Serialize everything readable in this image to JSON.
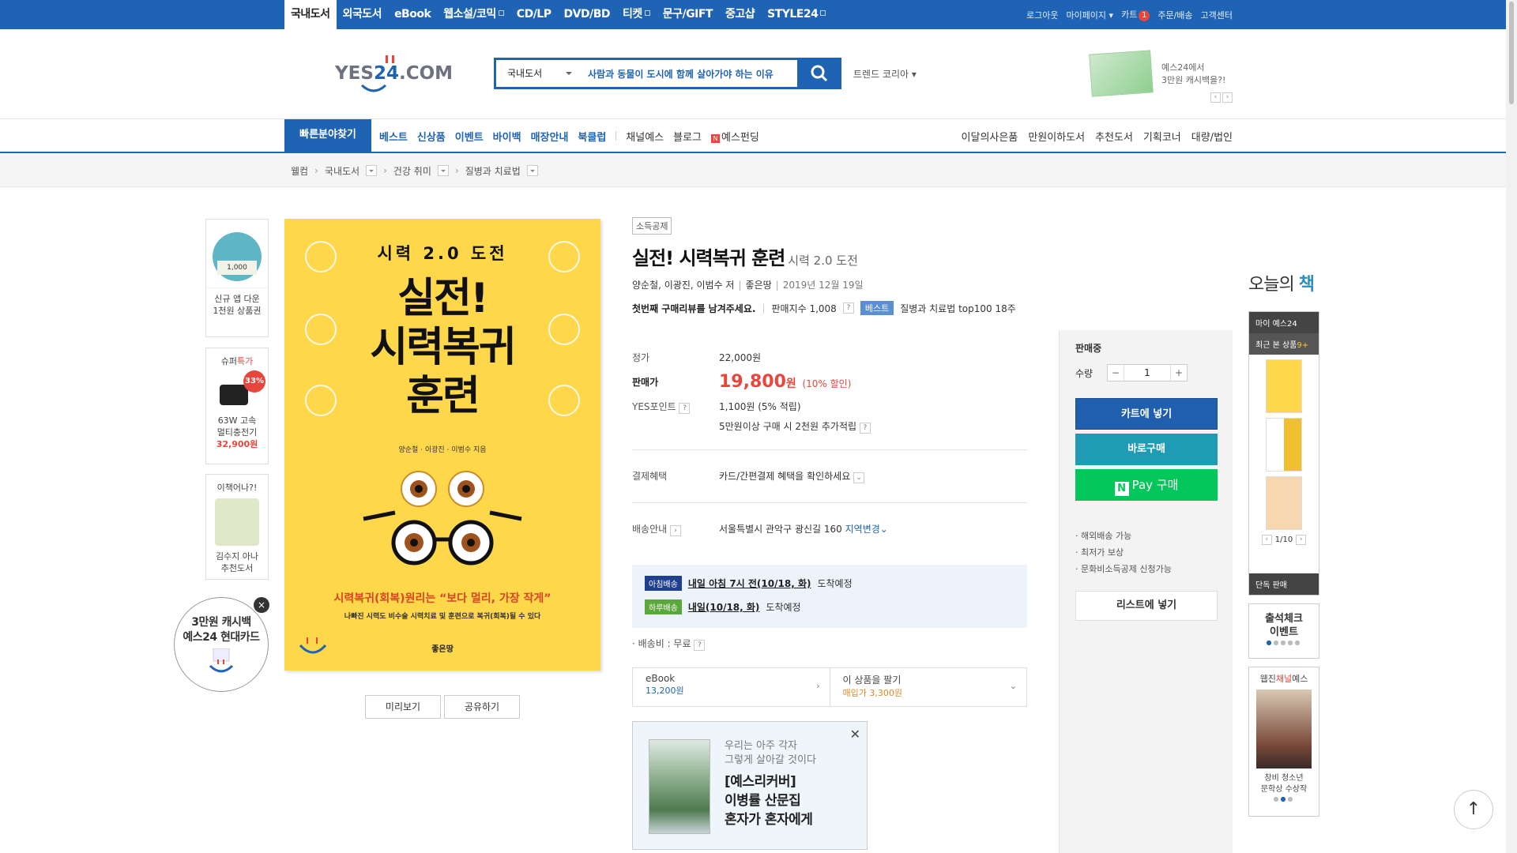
{
  "topbar": {
    "tabs": [
      {
        "label": "국내도서",
        "active": true
      },
      {
        "label": "외국도서"
      },
      {
        "label": "eBook"
      },
      {
        "label": "웹소설/코믹",
        "more": true
      },
      {
        "label": "CD/LP"
      },
      {
        "label": "DVD/BD"
      },
      {
        "label": "티켓",
        "more": true
      },
      {
        "label": "문구/GIFT"
      },
      {
        "label": "중고샵"
      },
      {
        "label": "STYLE24",
        "more": true
      }
    ],
    "util": {
      "logout": "로그아웃",
      "mypage": "마이페이지",
      "cart": "카트",
      "cart_count": "1",
      "orders": "주문/배송",
      "cs": "고객센터"
    }
  },
  "header": {
    "logo": {
      "yes": "YES",
      "n24": "24",
      "com": ".COM"
    },
    "search": {
      "category": "국내도서",
      "query": "사람과 동물이 도시에 함께 살아가야 하는 이유"
    },
    "trend": "트렌드 코리아",
    "promo": {
      "line1": "예스24에서",
      "line2": "3만원 캐시백을?!"
    }
  },
  "gnb": {
    "quick": "빠른분야찾기",
    "menu_blue": [
      "베스트",
      "신상품",
      "이벤트",
      "바이백",
      "매장안내",
      "북클럽"
    ],
    "menu_gray": [
      "채널예스",
      "블로그"
    ],
    "funding": "예스펀딩",
    "right": [
      "이달의사은품",
      "만원이하도서",
      "추천도서",
      "기획코너",
      "대량/법인"
    ]
  },
  "breadcrumb": [
    "웰컴",
    "국내도서",
    "건강 취미",
    "질병과 치료법"
  ],
  "side_ads": {
    "app": {
      "coin": "1,000",
      "line1": "신규 앱 다운",
      "line2": "1천원 상품권"
    },
    "super": {
      "title_a": "슈퍼",
      "title_b": "특가",
      "pct": "33%",
      "line1": "63W 고속",
      "line2": "멀티충전기",
      "price": "32,900원"
    },
    "book": {
      "title": "이책어나?!",
      "line1": "김수지 아나",
      "line2": "추천도서"
    },
    "circle": {
      "line1": "3만원 캐시백",
      "line2": "예스24 현대카드"
    }
  },
  "cover": {
    "subtitle": "시력 2.0 도전",
    "title_lines": [
      "실전!",
      "시력복귀",
      "훈련"
    ],
    "authors": "양순철 · 이광진 · 이범수 지음",
    "tagline": "시력복귀(회복)원리는 “보다 멀리, 가장 작게”",
    "tagline2": "나빠진 시력도 비수술 시력치료 및 훈련으로 복귀(회복)될 수 있다",
    "publisher": "좋은땅"
  },
  "cover_buttons": {
    "preview": "미리보기",
    "share": "공유하기"
  },
  "product": {
    "badge": "소득공제",
    "title": "실전! 시력복귀 훈련",
    "subtitle": "시력 2.0 도전",
    "authors": "양순철, 이광진, 이범수 저",
    "publisher": "좋은땅",
    "date": "2019년 12월 19일",
    "review_prompt": "첫번째 구매리뷰를 남겨주세요.",
    "sales_index": "판매지수 1,008",
    "best_tag": "베스트",
    "rank": "질병과 치료법 top100 18주"
  },
  "price": {
    "list_label": "정가",
    "list_value": "22,000원",
    "sale_label": "판매가",
    "sale_value": "19,800",
    "sale_unit": "원",
    "discount": "(10% 할인)",
    "points_label": "YES포인트",
    "points_value": "1,100원 (5% 적립)",
    "points_extra": "5만원이상 구매 시 2천원 추가적립",
    "pay_label": "결제혜택",
    "pay_value": "카드/간편결제 혜택을 확인하세요",
    "ship_label": "배송안내",
    "ship_address": "서울특별시 관악구 광신길 160",
    "ship_change": "지역변경"
  },
  "delivery": {
    "morning_tag": "아침배송",
    "morning_time": "내일 아침 7시 전(10/18, 화)",
    "morning_suffix": "도착예정",
    "day_tag": "하루배송",
    "day_time": "내일(10/18, 화)",
    "day_suffix": "도착예정",
    "fee": "· 배송비 : 무료"
  },
  "ebook": {
    "label": "eBook",
    "price": "13,200원",
    "sell_label": "이 상품을 팔기",
    "sell_price": "매입가 3,300원"
  },
  "banner": {
    "line1": "우리는 아주 각자",
    "line2": "그렇게 살아갈 것이다",
    "t1": "[예스리커버]",
    "t2": "이병률 산문집",
    "t3": "혼자가 혼자에게"
  },
  "buy": {
    "status": "판매중",
    "qty_label": "수량",
    "qty": "1",
    "cart": "카트에 넣기",
    "buy_now": "바로구매",
    "npay": "Pay 구매",
    "notes": [
      "· 해외배송 가능",
      "· 최저가 보상",
      "· 문화비소득공제 신청가능"
    ],
    "wishlist": "리스트에 넣기"
  },
  "right": {
    "today_a": "오늘의",
    "today_b": "책",
    "my": "마이 예스24",
    "recent": "최근 본 상품",
    "recent_count": "9+",
    "page": "1/10",
    "exclusive": "단독 판매",
    "attend_line1": "출석체크",
    "attend_line2": "이벤트",
    "webzine_a": "웹진",
    "webzine_b": "채널",
    "webzine_c": "예스",
    "webzine_cap1": "창비 청소년",
    "webzine_cap2": "문학상 수상작"
  },
  "colors": {
    "brand": "#1f63b5",
    "price_red": "#e8453c",
    "buy_teal": "#1f9bb5",
    "npay_green": "#03c75a"
  }
}
